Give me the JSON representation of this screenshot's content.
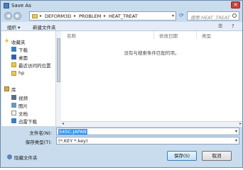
{
  "window": {
    "title": "Save As",
    "close_glyph": "✕"
  },
  "address": {
    "segments": [
      "DEFORM3D",
      "PROBLEM",
      "HEAT_TREAT"
    ],
    "separator": "▸",
    "search_placeholder": "搜索 HEAT_TREAT"
  },
  "toolbar": {
    "organize": "组织 ▾",
    "new_folder": "新建文件夹"
  },
  "sidebar": {
    "items": [
      {
        "label": "收藏夹",
        "icon": "star-icon"
      },
      {
        "label": "下载",
        "icon": "download-folder-icon"
      },
      {
        "label": "桌面",
        "icon": "desktop-icon"
      },
      {
        "label": "最近访问的位置",
        "icon": "recent-places-icon"
      },
      {
        "label": "hp",
        "icon": "user-folder-icon"
      },
      {
        "label": "库",
        "icon": "library-icon"
      },
      {
        "label": "视频",
        "icon": "video-icon"
      },
      {
        "label": "图片",
        "icon": "picture-icon"
      },
      {
        "label": "文档",
        "icon": "document-icon"
      },
      {
        "label": "迅雷下载",
        "icon": "download-folder-icon"
      }
    ]
  },
  "file_list": {
    "columns": [
      "名称",
      "修改日期",
      "类型"
    ],
    "empty_message": "没有与搜索条件匹配的项。"
  },
  "form": {
    "filename_label": "文件名(N):",
    "filename_value": "S45C-JAPAN",
    "filetype_label": "保存类型(T):",
    "filetype_value": "(*.KEY *.key)"
  },
  "footer": {
    "hide_folders": "隐藏文件夹",
    "save": "保存(S)",
    "cancel": "取消"
  },
  "colors": {
    "accent": "#3399ff",
    "window_frame": "#c9dcee"
  }
}
